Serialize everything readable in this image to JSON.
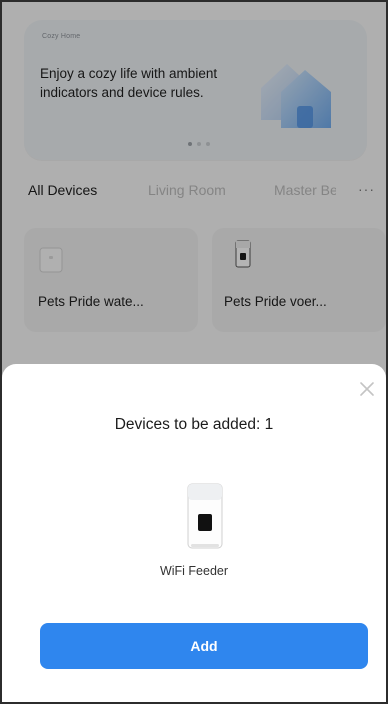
{
  "banner": {
    "brand": "Cozy Home",
    "text": "Enjoy a cozy life with ambient indicators and device rules.",
    "icon": "house-graphic-icon",
    "dots": 3,
    "active_dot": 1
  },
  "tabs": [
    {
      "label": "All Devices",
      "active": true
    },
    {
      "label": "Living Room",
      "active": false
    },
    {
      "label": "Master Bedroom",
      "active": false
    }
  ],
  "tabs_more_label": "···",
  "devices": [
    {
      "name": "Pets Pride wate...",
      "icon": "water-fountain-icon"
    },
    {
      "name": "Pets Pride voer...",
      "icon": "feeder-icon"
    }
  ],
  "sheet": {
    "title": "Devices to be added: 1",
    "device_name": "WiFi Feeder",
    "device_icon": "wifi-feeder-icon",
    "add_label": "Add",
    "close_icon": "close-icon"
  },
  "colors": {
    "accent": "#2f86ee",
    "overlay": "rgba(0,0,0,0.28)",
    "text_primary": "#1b1b1b",
    "tab_inactive": "#b8b8b8"
  }
}
